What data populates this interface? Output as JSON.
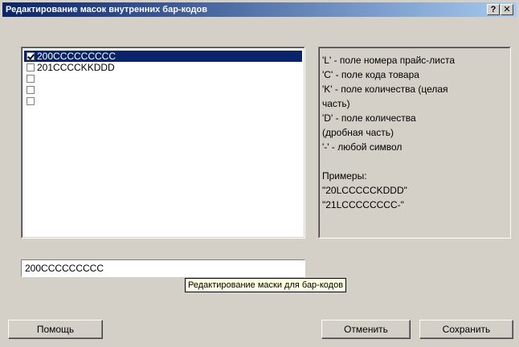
{
  "window": {
    "title": "Редактирование масок внутренних бар-кодов",
    "help_btn": "?",
    "close_btn": "✕"
  },
  "masks": [
    {
      "checked": true,
      "text": "200CCCCCCCCC",
      "selected": true
    },
    {
      "checked": false,
      "text": "201CCCCKKDDD",
      "selected": false
    },
    {
      "checked": false,
      "text": "",
      "selected": false
    },
    {
      "checked": false,
      "text": "",
      "selected": false
    },
    {
      "checked": false,
      "text": "",
      "selected": false
    }
  ],
  "help": {
    "lines": [
      "'L' - поле номера прайс-листа",
      "'C' - поле кода товара",
      "'K' - поле количества (целая",
      "часть)",
      "'D' - поле количества",
      "(дробная часть)",
      "'-' - любой символ",
      "",
      "Примеры:",
      "\"20LCCCCCKDDD\"",
      "\"21LCCCCCCCC-\""
    ]
  },
  "editor": {
    "value": "200CCCCCCCCC",
    "tooltip": "Редактирование маски для бар-кодов"
  },
  "buttons": {
    "help": "Помощь",
    "cancel": "Отменить",
    "save": "Сохранить"
  },
  "colors": {
    "title_start": "#0a246a",
    "title_end": "#a6caf0",
    "face": "#d4d0c8",
    "selection": "#0a246a",
    "tooltip_bg": "#ffffe1"
  }
}
